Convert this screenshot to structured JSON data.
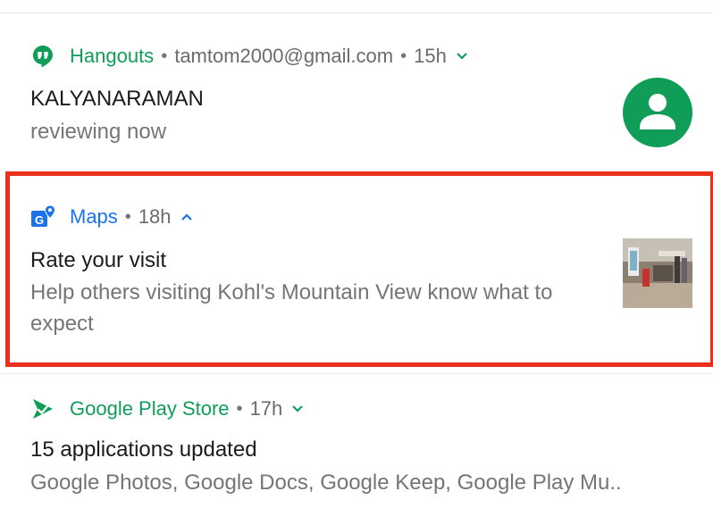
{
  "colors": {
    "hangouts_green": "#0f9d58",
    "maps_blue": "#1a73e8",
    "play_green": "#0f9d58",
    "highlight_red": "#ea2f1d",
    "secondary_text": "#757575"
  },
  "notifications": [
    {
      "app": "Hangouts",
      "app_icon": "hangouts-icon",
      "account": "tamtom2000@gmail.com",
      "time": "15h",
      "expanded": false,
      "title": "KALYANARAMAN",
      "text": "reviewing now",
      "large_icon": "account-avatar-icon"
    },
    {
      "app": "Maps",
      "app_icon": "maps-icon",
      "time": "18h",
      "expanded": true,
      "title": "Rate your visit",
      "text": "Help others visiting Kohl's Mountain View know what to expect",
      "large_icon": "store-photo-thumbnail",
      "highlighted": true
    },
    {
      "app": "Google Play Store",
      "app_icon": "play-store-icon",
      "time": "17h",
      "expanded": false,
      "title": "15 applications updated",
      "text": "Google Photos, Google Docs, Google Keep, Google Play Mu.."
    }
  ],
  "separator": "•"
}
